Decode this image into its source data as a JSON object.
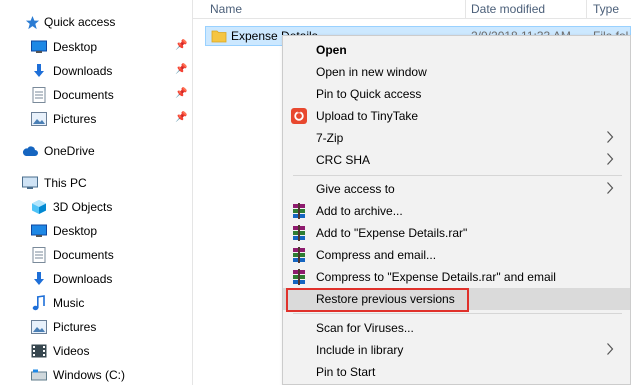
{
  "nav": {
    "quick_access": "Quick access",
    "qa_items": [
      {
        "label": "Desktop",
        "icon": "desktop-icon"
      },
      {
        "label": "Downloads",
        "icon": "downloads-icon"
      },
      {
        "label": "Documents",
        "icon": "documents-icon"
      },
      {
        "label": "Pictures",
        "icon": "pictures-icon"
      }
    ],
    "onedrive": "OneDrive",
    "this_pc": "This PC",
    "pc_items": [
      {
        "label": "3D Objects",
        "icon": "3d-objects-icon"
      },
      {
        "label": "Desktop",
        "icon": "desktop-icon"
      },
      {
        "label": "Documents",
        "icon": "documents-icon"
      },
      {
        "label": "Downloads",
        "icon": "downloads-icon"
      },
      {
        "label": "Music",
        "icon": "music-icon"
      },
      {
        "label": "Pictures",
        "icon": "pictures-icon"
      },
      {
        "label": "Videos",
        "icon": "videos-icon"
      },
      {
        "label": "Windows (C:)",
        "icon": "drive-icon"
      }
    ]
  },
  "file_list": {
    "columns": {
      "name": "Name",
      "date": "Date modified",
      "type": "Type"
    },
    "rows": [
      {
        "name": "Expense Details",
        "date": "2/9/2018 11:33 AM",
        "type": "File fol"
      }
    ]
  },
  "context_menu": {
    "items": {
      "open": "Open",
      "open_new_window": "Open in new window",
      "pin_quick_access": "Pin to Quick access",
      "upload_tinytake": "Upload to TinyTake",
      "seven_zip": "7-Zip",
      "crc_sha": "CRC SHA",
      "give_access": "Give access to",
      "add_archive": "Add to archive...",
      "add_rar": "Add to \"Expense Details.rar\"",
      "compress_email": "Compress and email...",
      "compress_rar_email": "Compress to \"Expense Details.rar\" and email",
      "restore_versions": "Restore previous versions",
      "scan_viruses": "Scan for Viruses...",
      "include_library": "Include in library",
      "pin_start": "Pin to Start"
    }
  },
  "colors": {
    "selection": "#cce8ff",
    "highlight_box": "#e0312b",
    "folder": "#f5c542"
  }
}
